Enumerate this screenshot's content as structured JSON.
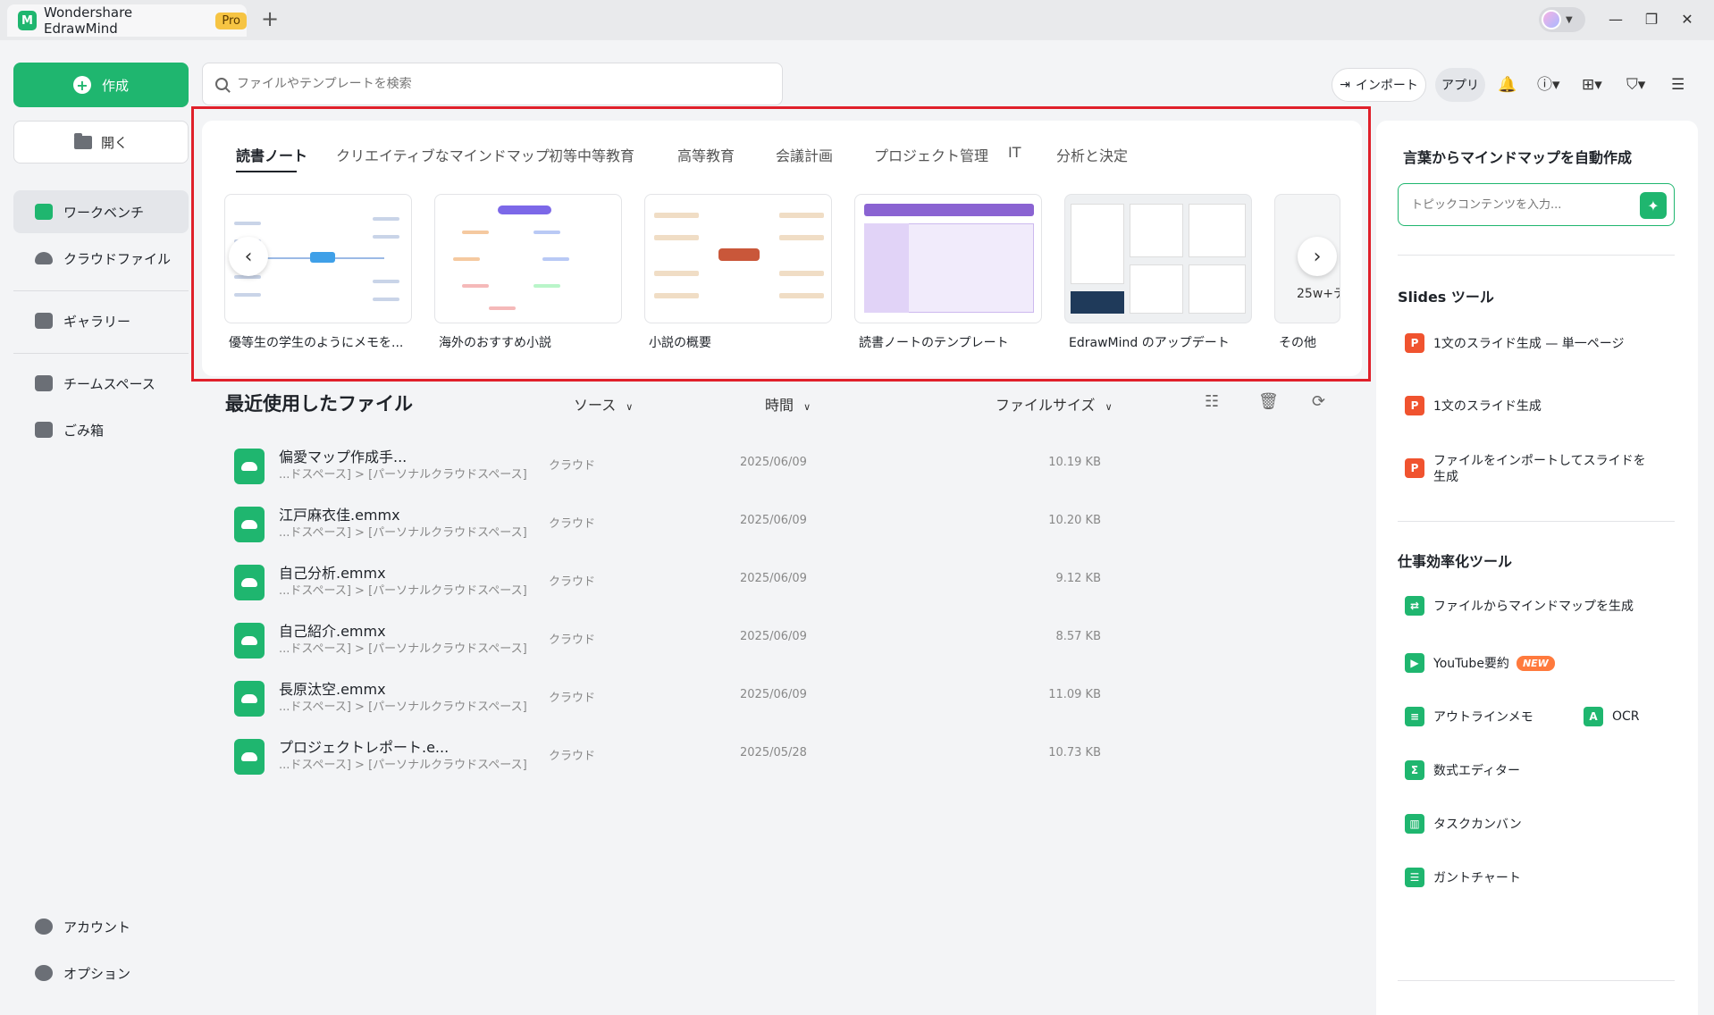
{
  "titlebar": {
    "app_title": "Wondershare EdrawMind",
    "pro_badge": "Pro",
    "new_tab": "+",
    "minimize": "—",
    "restore": "❐",
    "close": "✕"
  },
  "sidebar": {
    "create_label": "作成",
    "open_label": "開く",
    "nav": {
      "workbench": "ワークベンチ",
      "cloud": "クラウドファイル",
      "gallery": "ギャラリー",
      "teamspace": "チームスペース",
      "trash": "ごみ箱",
      "account": "アカウント",
      "options": "オプション"
    }
  },
  "toolbar": {
    "search_placeholder": "ファイルやテンプレートを検索",
    "import_label": "インポート",
    "app_label": "アプリ"
  },
  "templates": {
    "tabs": [
      "読書ノート",
      "クリエイティブなマインドマップ",
      "初等中等教育",
      "高等教育",
      "会議計画",
      "プロジェクト管理",
      "IT",
      "分析と決定"
    ],
    "cards": [
      "優等生の学生のようにメモを...",
      "海外のおすすめ小説",
      "小説の概要",
      "読書ノートのテンプレート",
      "EdrawMind のアップデート",
      "その他"
    ],
    "more_count": "25w+テ",
    "prev": "‹",
    "next": "›"
  },
  "recent": {
    "title": "最近使用したファイル",
    "col_source": "ソース",
    "col_time": "時間",
    "col_size": "ファイルサイズ",
    "files": [
      {
        "name": "偏愛マップ作成手...",
        "path": "...ドスペース] > [パーソナルクラウドスペース]",
        "source": "クラウド",
        "time": "2025/06/09",
        "size": "10.19 KB"
      },
      {
        "name": "江戸麻衣佳.emmx",
        "path": "...ドスペース] > [パーソナルクラウドスペース]",
        "source": "クラウド",
        "time": "2025/06/09",
        "size": "10.20 KB"
      },
      {
        "name": "自己分析.emmx",
        "path": "...ドスペース] > [パーソナルクラウドスペース]",
        "source": "クラウド",
        "time": "2025/06/09",
        "size": "9.12 KB"
      },
      {
        "name": "自己紹介.emmx",
        "path": "...ドスペース] > [パーソナルクラウドスペース]",
        "source": "クラウド",
        "time": "2025/06/09",
        "size": "8.57 KB"
      },
      {
        "name": "長原汰空.emmx",
        "path": "...ドスペース] > [パーソナルクラウドスペース]",
        "source": "クラウド",
        "time": "2025/06/09",
        "size": "11.09 KB"
      },
      {
        "name": "プロジェクトレポート.e...",
        "path": "...ドスペース] > [パーソナルクラウドスペース]",
        "source": "クラウド",
        "time": "2025/05/28",
        "size": "10.73 KB"
      }
    ]
  },
  "right_panel": {
    "ai_title": "言葉からマインドマップを自動作成",
    "topic_placeholder": "トピックコンテンツを入力...",
    "slides_title": "Slides ツール",
    "slides": [
      "1文のスライド生成 — 単一ページ",
      "1文のスライド生成",
      "ファイルをインポートしてスライドを生成"
    ],
    "tools_title": "仕事効率化ツール",
    "tools": {
      "file_to_mindmap": "ファイルからマインドマップを生成",
      "youtube": "YouTube要約",
      "new_badge": "NEW",
      "outline": "アウトラインメモ",
      "ocr": "OCR",
      "formula": "数式エディター",
      "kanban": "タスクカンバン",
      "gantt": "ガントチャート"
    }
  },
  "colors": {
    "accent": "#1fb66f",
    "highlight": "#e0202a",
    "slides_orange": "#f0532f"
  }
}
